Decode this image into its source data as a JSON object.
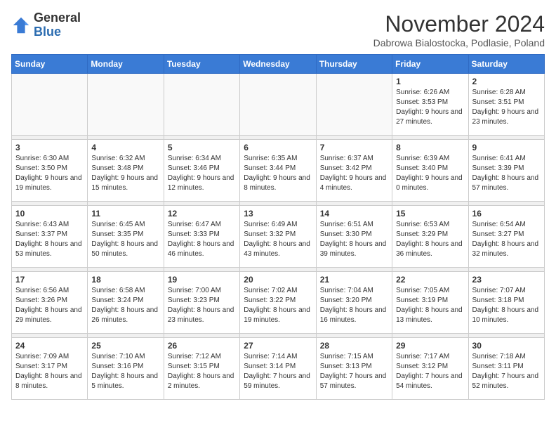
{
  "header": {
    "logo_general": "General",
    "logo_blue": "Blue",
    "month_title": "November 2024",
    "location": "Dabrowa Bialostocka, Podlasie, Poland"
  },
  "days_of_week": [
    "Sunday",
    "Monday",
    "Tuesday",
    "Wednesday",
    "Thursday",
    "Friday",
    "Saturday"
  ],
  "weeks": [
    [
      {
        "day": "",
        "info": ""
      },
      {
        "day": "",
        "info": ""
      },
      {
        "day": "",
        "info": ""
      },
      {
        "day": "",
        "info": ""
      },
      {
        "day": "",
        "info": ""
      },
      {
        "day": "1",
        "info": "Sunrise: 6:26 AM\nSunset: 3:53 PM\nDaylight: 9 hours and 27 minutes."
      },
      {
        "day": "2",
        "info": "Sunrise: 6:28 AM\nSunset: 3:51 PM\nDaylight: 9 hours and 23 minutes."
      }
    ],
    [
      {
        "day": "3",
        "info": "Sunrise: 6:30 AM\nSunset: 3:50 PM\nDaylight: 9 hours and 19 minutes."
      },
      {
        "day": "4",
        "info": "Sunrise: 6:32 AM\nSunset: 3:48 PM\nDaylight: 9 hours and 15 minutes."
      },
      {
        "day": "5",
        "info": "Sunrise: 6:34 AM\nSunset: 3:46 PM\nDaylight: 9 hours and 12 minutes."
      },
      {
        "day": "6",
        "info": "Sunrise: 6:35 AM\nSunset: 3:44 PM\nDaylight: 9 hours and 8 minutes."
      },
      {
        "day": "7",
        "info": "Sunrise: 6:37 AM\nSunset: 3:42 PM\nDaylight: 9 hours and 4 minutes."
      },
      {
        "day": "8",
        "info": "Sunrise: 6:39 AM\nSunset: 3:40 PM\nDaylight: 9 hours and 0 minutes."
      },
      {
        "day": "9",
        "info": "Sunrise: 6:41 AM\nSunset: 3:39 PM\nDaylight: 8 hours and 57 minutes."
      }
    ],
    [
      {
        "day": "10",
        "info": "Sunrise: 6:43 AM\nSunset: 3:37 PM\nDaylight: 8 hours and 53 minutes."
      },
      {
        "day": "11",
        "info": "Sunrise: 6:45 AM\nSunset: 3:35 PM\nDaylight: 8 hours and 50 minutes."
      },
      {
        "day": "12",
        "info": "Sunrise: 6:47 AM\nSunset: 3:33 PM\nDaylight: 8 hours and 46 minutes."
      },
      {
        "day": "13",
        "info": "Sunrise: 6:49 AM\nSunset: 3:32 PM\nDaylight: 8 hours and 43 minutes."
      },
      {
        "day": "14",
        "info": "Sunrise: 6:51 AM\nSunset: 3:30 PM\nDaylight: 8 hours and 39 minutes."
      },
      {
        "day": "15",
        "info": "Sunrise: 6:53 AM\nSunset: 3:29 PM\nDaylight: 8 hours and 36 minutes."
      },
      {
        "day": "16",
        "info": "Sunrise: 6:54 AM\nSunset: 3:27 PM\nDaylight: 8 hours and 32 minutes."
      }
    ],
    [
      {
        "day": "17",
        "info": "Sunrise: 6:56 AM\nSunset: 3:26 PM\nDaylight: 8 hours and 29 minutes."
      },
      {
        "day": "18",
        "info": "Sunrise: 6:58 AM\nSunset: 3:24 PM\nDaylight: 8 hours and 26 minutes."
      },
      {
        "day": "19",
        "info": "Sunrise: 7:00 AM\nSunset: 3:23 PM\nDaylight: 8 hours and 23 minutes."
      },
      {
        "day": "20",
        "info": "Sunrise: 7:02 AM\nSunset: 3:22 PM\nDaylight: 8 hours and 19 minutes."
      },
      {
        "day": "21",
        "info": "Sunrise: 7:04 AM\nSunset: 3:20 PM\nDaylight: 8 hours and 16 minutes."
      },
      {
        "day": "22",
        "info": "Sunrise: 7:05 AM\nSunset: 3:19 PM\nDaylight: 8 hours and 13 minutes."
      },
      {
        "day": "23",
        "info": "Sunrise: 7:07 AM\nSunset: 3:18 PM\nDaylight: 8 hours and 10 minutes."
      }
    ],
    [
      {
        "day": "24",
        "info": "Sunrise: 7:09 AM\nSunset: 3:17 PM\nDaylight: 8 hours and 8 minutes."
      },
      {
        "day": "25",
        "info": "Sunrise: 7:10 AM\nSunset: 3:16 PM\nDaylight: 8 hours and 5 minutes."
      },
      {
        "day": "26",
        "info": "Sunrise: 7:12 AM\nSunset: 3:15 PM\nDaylight: 8 hours and 2 minutes."
      },
      {
        "day": "27",
        "info": "Sunrise: 7:14 AM\nSunset: 3:14 PM\nDaylight: 7 hours and 59 minutes."
      },
      {
        "day": "28",
        "info": "Sunrise: 7:15 AM\nSunset: 3:13 PM\nDaylight: 7 hours and 57 minutes."
      },
      {
        "day": "29",
        "info": "Sunrise: 7:17 AM\nSunset: 3:12 PM\nDaylight: 7 hours and 54 minutes."
      },
      {
        "day": "30",
        "info": "Sunrise: 7:18 AM\nSunset: 3:11 PM\nDaylight: 7 hours and 52 minutes."
      }
    ]
  ]
}
